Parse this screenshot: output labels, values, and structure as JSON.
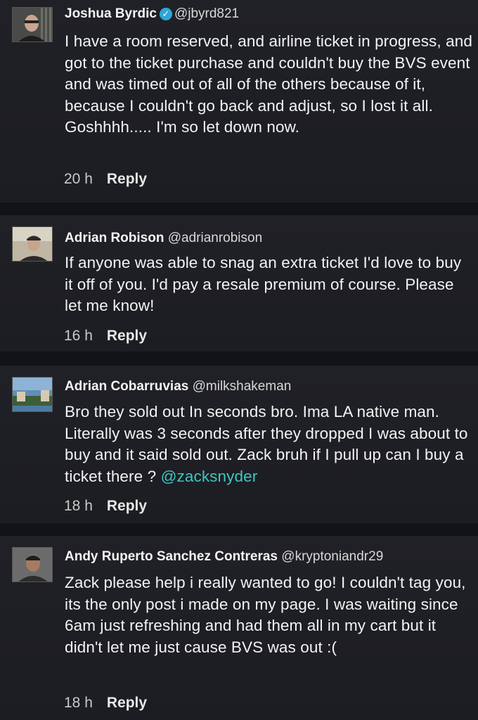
{
  "comments": [
    {
      "name": "Joshua Byrdic",
      "verified": true,
      "handle": "@jbyrd821",
      "text": "I have a room reserved,  and airline ticket in progress,  and got to the ticket purchase and couldn't buy the BVS event and was timed out of all of the others because of it, because I couldn't go back and adjust, so I lost it all.  Goshhhh..... I'm so let down now.",
      "time": "20 h",
      "reply_label": "Reply"
    },
    {
      "name": "Adrian Robison",
      "verified": false,
      "handle": "@adrianrobison",
      "text": "If anyone was able to snag an extra ticket I'd love to buy it off of you.  I'd pay a resale premium of course.  Please let me know!",
      "time": "16 h",
      "reply_label": "Reply"
    },
    {
      "name": "Adrian Cobarruvias",
      "verified": false,
      "handle": "@milkshakeman",
      "text": "Bro they sold out In seconds bro. Ima LA native man. Literally was 3 seconds after they dropped I was about to buy and it said sold out. Zack bruh if I pull up can I buy a ticket there ?",
      "mention": "@zacksnyder",
      "time": "18 h",
      "reply_label": "Reply"
    },
    {
      "name": "Andy Ruperto Sanchez Contreras",
      "verified": false,
      "handle": "@kryptoniandr29",
      "text": "Zack please help i really wanted to go! I couldn't tag you, its the only post i made on my page. I was waiting since 6am just refreshing and had them all in my cart but it didn't let me just cause BVS was out :(",
      "time": "18 h",
      "reply_label": "Reply"
    }
  ],
  "colors": {
    "background": "#1a1b1f",
    "mention": "#3ec6c2",
    "verified_badge": "#2fa6d9"
  },
  "icons": {
    "verified": "verified-check-icon"
  }
}
